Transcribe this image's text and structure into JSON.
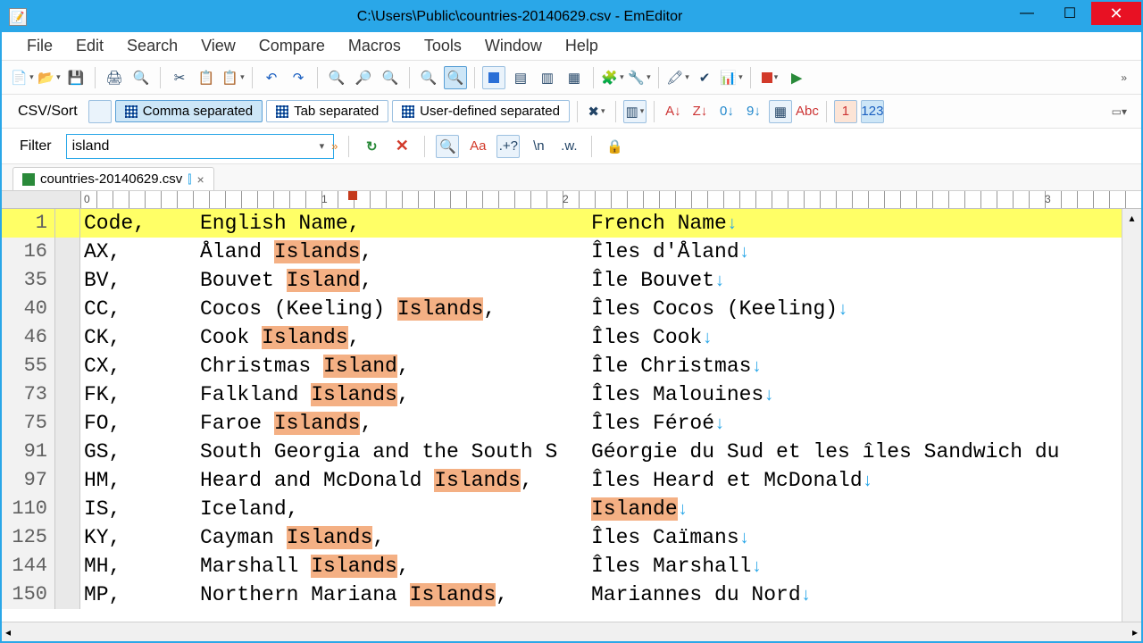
{
  "title": "C:\\Users\\Public\\countries-20140629.csv - EmEditor",
  "menu": [
    "File",
    "Edit",
    "Search",
    "View",
    "Compare",
    "Macros",
    "Tools",
    "Window",
    "Help"
  ],
  "csvbar": {
    "label": "CSV/Sort",
    "comma": "Comma separated",
    "tab": "Tab separated",
    "user": "User-defined separated"
  },
  "filter": {
    "label": "Filter",
    "value": "island"
  },
  "tab": {
    "name": "countries-20140629.csv",
    "close": "×"
  },
  "ruler": {
    "t0": "0",
    "t1": "1",
    "t2": "2",
    "t3": "3"
  },
  "header": {
    "line": "1",
    "code": "Code,",
    "en": "English Name,",
    "fr": "French Name"
  },
  "rows": [
    {
      "line": "16",
      "code": "AX,",
      "en": [
        [
          "Åland "
        ],
        [
          "Islands",
          true
        ],
        [
          ","
        ]
      ],
      "fr": [
        [
          "Îles d'Åland"
        ]
      ]
    },
    {
      "line": "35",
      "code": "BV,",
      "en": [
        [
          "Bouvet "
        ],
        [
          "Island",
          true
        ],
        [
          ","
        ]
      ],
      "fr": [
        [
          "Île Bouvet"
        ]
      ]
    },
    {
      "line": "40",
      "code": "CC,",
      "en": [
        [
          "Cocos (Keeling) "
        ],
        [
          "Islands",
          true
        ],
        [
          ","
        ]
      ],
      "fr": [
        [
          "Îles Cocos (Keeling)"
        ]
      ]
    },
    {
      "line": "46",
      "code": "CK,",
      "en": [
        [
          "Cook "
        ],
        [
          "Islands",
          true
        ],
        [
          ","
        ]
      ],
      "fr": [
        [
          "Îles Cook"
        ]
      ]
    },
    {
      "line": "55",
      "code": "CX,",
      "en": [
        [
          "Christmas "
        ],
        [
          "Island",
          true
        ],
        [
          ","
        ]
      ],
      "fr": [
        [
          "Île Christmas"
        ]
      ]
    },
    {
      "line": "73",
      "code": "FK,",
      "en": [
        [
          "Falkland "
        ],
        [
          "Islands",
          true
        ],
        [
          ","
        ]
      ],
      "fr": [
        [
          "Îles Malouines"
        ]
      ]
    },
    {
      "line": "75",
      "code": "FO,",
      "en": [
        [
          "Faroe "
        ],
        [
          "Islands",
          true
        ],
        [
          ","
        ]
      ],
      "fr": [
        [
          "Îles Féroé"
        ]
      ]
    },
    {
      "line": "91",
      "code": "GS,",
      "en": [
        [
          "South Georgia and the South S"
        ]
      ],
      "fr": [
        [
          "Géorgie du Sud et les îles Sandwich du"
        ]
      ],
      "noeol": true
    },
    {
      "line": "97",
      "code": "HM,",
      "en": [
        [
          "Heard and McDonald "
        ],
        [
          "Islands",
          true
        ],
        [
          ","
        ]
      ],
      "fr": [
        [
          "Îles Heard et McDonald"
        ]
      ]
    },
    {
      "line": "110",
      "code": "IS,",
      "en": [
        [
          "Iceland,"
        ]
      ],
      "fr": [
        [
          "Islande",
          true
        ]
      ]
    },
    {
      "line": "125",
      "code": "KY,",
      "en": [
        [
          "Cayman "
        ],
        [
          "Islands",
          true
        ],
        [
          ","
        ]
      ],
      "fr": [
        [
          "Îles Caïmans"
        ]
      ]
    },
    {
      "line": "144",
      "code": "MH,",
      "en": [
        [
          "Marshall "
        ],
        [
          "Islands",
          true
        ],
        [
          ","
        ]
      ],
      "fr": [
        [
          "Îles Marshall"
        ]
      ]
    },
    {
      "line": "150",
      "code": "MP,",
      "en": [
        [
          "Northern Mariana "
        ],
        [
          "Islands",
          true
        ],
        [
          ","
        ]
      ],
      "fr": [
        [
          "Mariannes du Nord"
        ]
      ]
    }
  ],
  "eol_glyph": "↓"
}
